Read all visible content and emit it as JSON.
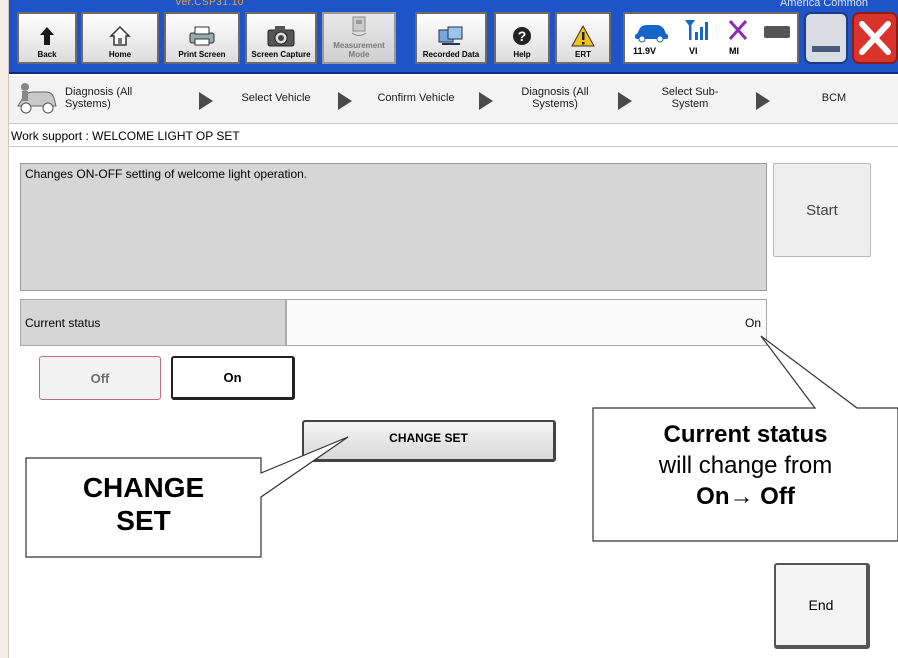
{
  "app": {
    "version": "Ver.CSP31.10",
    "market": "America Common"
  },
  "toolbar": {
    "buttons": [
      {
        "label": "Back",
        "icon": "back-arrow-icon"
      },
      {
        "label": "Home",
        "icon": "home-icon"
      },
      {
        "label": "Print Screen",
        "icon": "printer-icon"
      },
      {
        "label": "Screen Capture",
        "icon": "camera-icon"
      },
      {
        "label": "Measurement Mode",
        "icon": "measurement-icon"
      },
      {
        "label": "Recorded Data",
        "icon": "recorded-data-icon"
      },
      {
        "label": "Help",
        "icon": "help-icon"
      },
      {
        "label": "ERT",
        "icon": "warning-icon"
      }
    ],
    "status": {
      "voltage": "11.9V",
      "vi": "VI",
      "mi": "MI"
    }
  },
  "breadcrumb": [
    "Diagnosis (All Systems)",
    "Select Vehicle",
    "Confirm Vehicle",
    "Diagnosis (All Systems)",
    "Select Sub-System",
    "BCM"
  ],
  "work_support": {
    "title": "Work support : WELCOME LIGHT OP SET",
    "description": "Changes ON-OFF setting of welcome light operation.",
    "start_label": "Start",
    "current_status_label": "Current status",
    "current_status_value": "On",
    "off_label": "Off",
    "on_label": "On",
    "change_set_label": "CHANGE SET",
    "end_label": "End"
  },
  "annotations": {
    "change_set_line1": "CHANGE",
    "change_set_line2": "SET",
    "status_bold": "Current status",
    "status_line2": "will change from",
    "status_line3": "On→ Off"
  },
  "colors": {
    "toolbar_blue": "#1f54c6",
    "close_red": "#d9342b",
    "ert_yellow": "#f2c21b",
    "signal_blue": "#1466c8",
    "mi_purple": "#8a2bb5"
  }
}
